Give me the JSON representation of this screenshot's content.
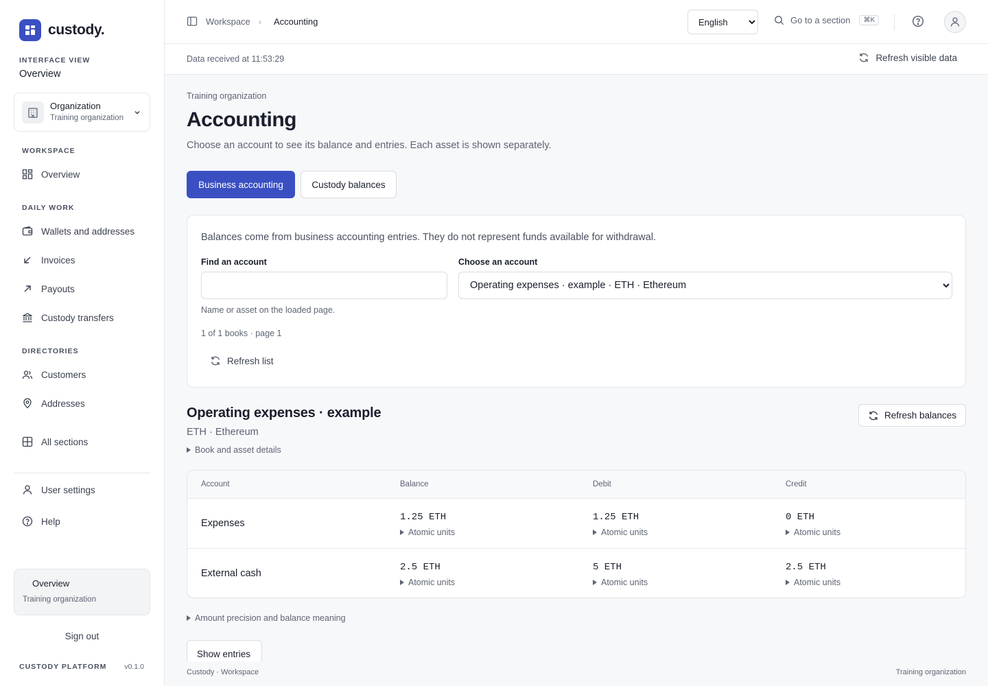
{
  "brand": {
    "name": "custody."
  },
  "sidebar": {
    "interface_view_label": "INTERFACE VIEW",
    "interface_view_value": "Overview",
    "org": {
      "title": "Organization",
      "subtitle": "Training organization"
    },
    "sections": {
      "workspace": "WORKSPACE",
      "daily_work": "DAILY WORK",
      "directories": "DIRECTORIES"
    },
    "items": {
      "overview": "Overview",
      "wallets": "Wallets and addresses",
      "invoices": "Invoices",
      "payouts": "Payouts",
      "custody_transfers": "Custody transfers",
      "customers": "Customers",
      "addresses": "Addresses",
      "all_sections": "All sections",
      "user_settings": "User settings",
      "help": "Help"
    },
    "card": {
      "title": "Overview",
      "subtitle": "Training organization"
    },
    "sign_out": "Sign out",
    "platform": "CUSTODY PLATFORM",
    "version": "v0.1.0"
  },
  "topbar": {
    "breadcrumb": [
      "Workspace",
      "Accounting"
    ],
    "language": "English",
    "language_options": [
      "English"
    ],
    "goto": "Go to a section",
    "shortcut": "⌘K"
  },
  "status": {
    "data_received": "Data received at 11:53:29",
    "refresh_visible": "Refresh visible data"
  },
  "main": {
    "org_crumb": "Training organization",
    "title": "Accounting",
    "description": "Choose an account to see its balance and entries. Each asset is shown separately.",
    "tabs": [
      "Business accounting",
      "Custody balances"
    ],
    "filter": {
      "note": "Balances come from business accounting entries. They do not represent funds available for withdrawal.",
      "find_label": "Find an account",
      "find_value": "",
      "find_hint": "Name or asset on the loaded page.",
      "choose_label": "Choose an account",
      "choose_value": "Operating expenses · example · ETH · Ethereum",
      "count": "1 of 1 books · page 1",
      "refresh_list": "Refresh list"
    },
    "account": {
      "title": "Operating expenses · example",
      "subtitle": "ETH · Ethereum",
      "details_toggle": "Book and asset details",
      "refresh_balances": "Refresh balances"
    },
    "table": {
      "headers": [
        "Account",
        "Balance",
        "Debit",
        "Credit"
      ],
      "atomic_label": "Atomic units",
      "rows": [
        {
          "name": "Expenses",
          "balance": "1.25 ETH",
          "debit": "1.25 ETH",
          "credit": "0 ETH"
        },
        {
          "name": "External cash",
          "balance": "2.5 ETH",
          "debit": "5 ETH",
          "credit": "2.5 ETH"
        }
      ]
    },
    "precision_toggle": "Amount precision and balance meaning",
    "show_entries": "Show entries"
  },
  "footer": {
    "left": "Custody · Workspace",
    "right": "Training organization"
  },
  "colors": {
    "accent": "#3a4fc2",
    "text": "#1a1f2c",
    "muted": "#5d6473",
    "border": "#e3e6ea",
    "background": "#f7f8fa"
  }
}
